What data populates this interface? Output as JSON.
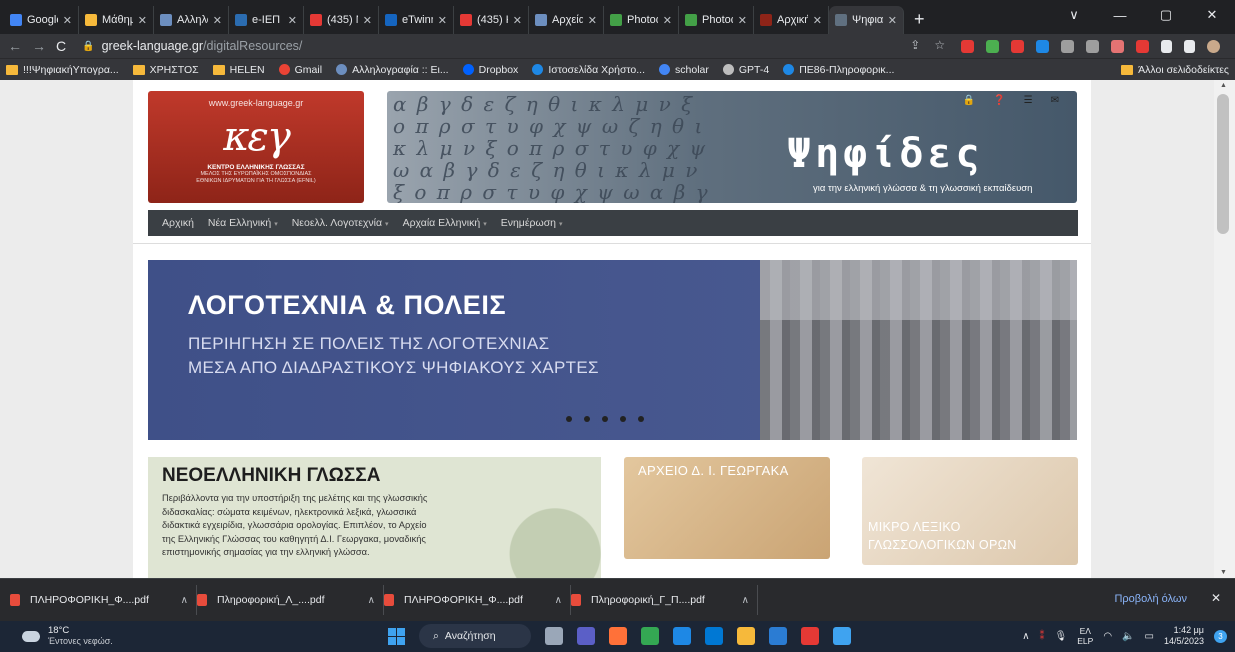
{
  "browser": {
    "tabs": [
      {
        "label": "Google",
        "color": "#4285f4"
      },
      {
        "label": "Μάθημα",
        "color": "#f6b93b"
      },
      {
        "label": "Αλληλο",
        "color": "#6c8ebf"
      },
      {
        "label": "e-ΙΕΠ",
        "color": "#2b6cb0"
      },
      {
        "label": "(435) Ν",
        "color": "#e53935"
      },
      {
        "label": "eTwinni",
        "color": "#1565c0"
      },
      {
        "label": "(435) Κ",
        "color": "#e53935"
      },
      {
        "label": "Αρχεία",
        "color": "#6c8ebf"
      },
      {
        "label": "Photod",
        "color": "#43a047"
      },
      {
        "label": "Photod",
        "color": "#43a047"
      },
      {
        "label": "Αρχική",
        "color": "#8e2418"
      },
      {
        "label": "Ψηφιακ",
        "color": "#607080"
      }
    ],
    "active_tab_index": 11,
    "window_controls": [
      "∨",
      "—",
      "▢",
      "✕"
    ],
    "address": {
      "host": "greek-language.gr",
      "path": "/digitalResources/"
    },
    "bookmarks": [
      {
        "label": "!!!ΨηφιακήΥπογρα...",
        "icon": "folder-icon",
        "color": "#f6b93b"
      },
      {
        "label": "ΧΡΗΣΤΟΣ",
        "icon": "folder-icon",
        "color": "#f6b93b"
      },
      {
        "label": "HELEN",
        "icon": "folder-icon",
        "color": "#f6b93b"
      },
      {
        "label": "Gmail",
        "icon": "gmail-icon",
        "color": "#ea4335"
      },
      {
        "label": "Αλληλογραφία :: Ει...",
        "icon": "mail-icon",
        "color": "#6c8ebf"
      },
      {
        "label": "Dropbox",
        "icon": "dropbox-icon",
        "color": "#0061fe"
      },
      {
        "label": "Ιστοσελίδα Χρήστο...",
        "icon": "site-icon",
        "color": "#1e88e5"
      },
      {
        "label": "scholar",
        "icon": "scholar-icon",
        "color": "#4285f4"
      },
      {
        "label": "GPT-4",
        "icon": "openai-icon",
        "color": "#bdbdbd"
      },
      {
        "label": "ΠΕ86-Πληροφορικ...",
        "icon": "site-icon",
        "color": "#1e88e5"
      }
    ],
    "other_bookmarks": "Άλλοι σελιδοδείκτες"
  },
  "site": {
    "logo": {
      "url": "www.greek-language.gr",
      "center": "ΚΕΝΤΡΟ ΕΛΛΗΝΙΚΗΣ ΓΛΩΣΣΑΣ",
      "member_line1": "ΜΕΛΟΣ ΤΗΣ ΕΥΡΩΠΑΪΚΗΣ ΟΜΟΣΠΟΝΔΙΑΣ",
      "member_line2": "ΕΘΝΙΚΩΝ ΙΔΡΥΜΑΤΩΝ ΓΙΑ ΤΗ ΓΛΩΣΣΑ (EFNIL)"
    },
    "banner": {
      "letters": "α β γ δ ε ζ η θ ι κ λ μ ν ξ ο π ρ σ τ υ φ χ ψ ω ζ η θ ι κ λ μ ν ξ ο π ρ σ τ υ φ χ ψ ω α β γ δ ε ζ η θ ι κ λ μ ν ξ ο π ρ σ τ υ φ χ ψ ω α β γ δ ε ζ η θ ι κ λ μ ν ξ ο π ρ σ τ υ φ χ ψ ω",
      "title": "Ψηφίδες",
      "tagline": "για την ελληνική γλώσσα & τη γλωσσική εκπαίδευση"
    },
    "menu": [
      {
        "label": "Αρχική",
        "dropdown": false
      },
      {
        "label": "Νέα Ελληνική",
        "dropdown": true
      },
      {
        "label": "Νεοελλ. Λογοτεχνία",
        "dropdown": true
      },
      {
        "label": "Αρχαία Ελληνική",
        "dropdown": true
      },
      {
        "label": "Ενημέρωση",
        "dropdown": true
      }
    ],
    "hero": {
      "title": "ΛΟΓΟΤΕΧΝΙΑ & ΠΟΛΕΙΣ",
      "line1": "ΠΕΡΙΗΓΗΣΗ ΣΕ ΠΟΛΕΙΣ ΤΗΣ ΛΟΓΟΤΕΧΝΙΑΣ",
      "line2": "ΜΕΣΑ ΑΠΟ ΔΙΑΔΡΑΣΤΙΚΟΥΣ ΨΗΦΙΑΚΟΥΣ ΧΑΡΤΕΣ",
      "slides": 5
    },
    "tiles": {
      "main": {
        "title": "ΝΕΟΕΛΛΗΝΙΚΗ ΓΛΩΣΣΑ",
        "body": "Περιβάλλοντα για την υποστήριξη της μελέτης και της γλωσσικής διδασκαλίας: σώματα κειμένων, ηλεκτρονικά λεξικά, γλωσσικά διδακτικά εγχειρίδια, γλωσσάρια ορολογίας. Επιπλέον, το Αρχείο της Ελληνικής Γλώσσας του καθηγητή Δ.Ι. Γεωργακα, μοναδικής επιστημονικής σημασίας για την ελληνική γλώσσα."
      },
      "archive": "ΑΡΧΕΙΟ Δ. Ι. ΓΕΩΡΓΑΚΑ",
      "lexicon_line1": "ΜΙΚΡΟ ΛΕΞΙΚΟ",
      "lexicon_line2": "ΓΛΩΣΣΟΛΟΓΙΚΩΝ ΟΡΩΝ"
    }
  },
  "downloads": {
    "items": [
      "ΠΛΗΡΟΦΟΡΙΚΗ_Φ....pdf",
      "Πληροφορική_Λ_....pdf",
      "ΠΛΗΡΟΦΟΡΙΚΗ_Φ....pdf",
      "Πληροφορική_Γ_Π....pdf"
    ],
    "show_all": "Προβολή όλων"
  },
  "taskbar": {
    "temp": "18°C",
    "condition": "Έντονες νεφώσ.",
    "search": "Αναζήτηση",
    "apps": [
      {
        "name": "task-view-icon",
        "color": "#9aa7b8"
      },
      {
        "name": "teams-icon",
        "color": "#5b5fc7"
      },
      {
        "name": "firefox-icon",
        "color": "#ff7139"
      },
      {
        "name": "chrome-icon",
        "color": "#34a853"
      },
      {
        "name": "app-l-icon",
        "color": "#1e88e5"
      },
      {
        "name": "store-icon",
        "color": "#0078d4"
      },
      {
        "name": "explorer-icon",
        "color": "#f6b93b"
      },
      {
        "name": "word-icon",
        "color": "#2b7cd3"
      },
      {
        "name": "pdf-icon",
        "color": "#e53935"
      },
      {
        "name": "notes-icon",
        "color": "#3fa3f0"
      }
    ],
    "lang_top": "ΕΛ",
    "lang_bottom": "ELP",
    "time": "1:42 μμ",
    "date": "14/5/2023",
    "notif": "3"
  }
}
